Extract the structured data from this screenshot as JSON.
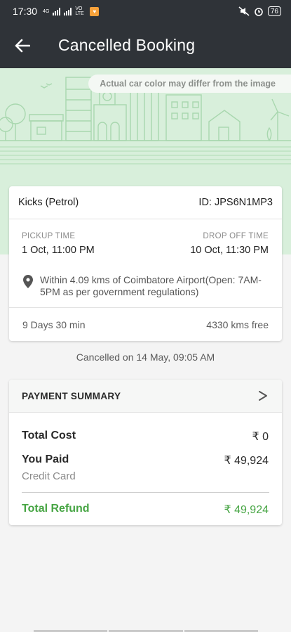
{
  "status_bar": {
    "time": "17:30",
    "network": "4G",
    "volte": "VO LTE",
    "battery": "76"
  },
  "header": {
    "title": "Cancelled Booking"
  },
  "banner": {
    "disclaimer": "Actual car color may differ from the image"
  },
  "booking": {
    "car": "Kicks (Petrol)",
    "booking_id": "ID: JPS6N1MP3",
    "pickup_label": "PICKUP TIME",
    "pickup_time": "1 Oct, 11:00 PM",
    "dropoff_label": "DROP OFF TIME",
    "dropoff_time": "10 Oct, 11:30 PM",
    "location": "Within 4.09 kms of Coimbatore Airport(Open: 7AM-5PM as per government regulations)",
    "duration": "9 Days 30 min",
    "free_kms": "4330 kms free"
  },
  "cancelled_note": "Cancelled on 14 May, 09:05 AM",
  "payment": {
    "title": "PAYMENT SUMMARY",
    "total_cost_label": "Total Cost",
    "total_cost": "₹ 0",
    "you_paid_label": "You Paid",
    "you_paid": "₹ 49,924",
    "method": "Credit Card",
    "refund_label": "Total Refund",
    "refund": "₹ 49,924"
  },
  "colors": {
    "app_bar": "#2f3338",
    "banner_bg": "#d8efdb",
    "refund_green": "#47a544"
  }
}
